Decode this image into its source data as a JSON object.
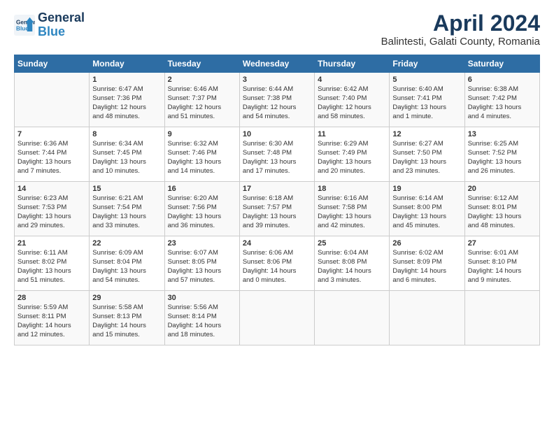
{
  "header": {
    "logo_line1": "General",
    "logo_line2": "Blue",
    "title": "April 2024",
    "subtitle": "Balintesti, Galati County, Romania"
  },
  "weekdays": [
    "Sunday",
    "Monday",
    "Tuesday",
    "Wednesday",
    "Thursday",
    "Friday",
    "Saturday"
  ],
  "weeks": [
    [
      {
        "day": "",
        "content": ""
      },
      {
        "day": "1",
        "content": "Sunrise: 6:47 AM\nSunset: 7:36 PM\nDaylight: 12 hours\nand 48 minutes."
      },
      {
        "day": "2",
        "content": "Sunrise: 6:46 AM\nSunset: 7:37 PM\nDaylight: 12 hours\nand 51 minutes."
      },
      {
        "day": "3",
        "content": "Sunrise: 6:44 AM\nSunset: 7:38 PM\nDaylight: 12 hours\nand 54 minutes."
      },
      {
        "day": "4",
        "content": "Sunrise: 6:42 AM\nSunset: 7:40 PM\nDaylight: 12 hours\nand 58 minutes."
      },
      {
        "day": "5",
        "content": "Sunrise: 6:40 AM\nSunset: 7:41 PM\nDaylight: 13 hours\nand 1 minute."
      },
      {
        "day": "6",
        "content": "Sunrise: 6:38 AM\nSunset: 7:42 PM\nDaylight: 13 hours\nand 4 minutes."
      }
    ],
    [
      {
        "day": "7",
        "content": "Sunrise: 6:36 AM\nSunset: 7:44 PM\nDaylight: 13 hours\nand 7 minutes."
      },
      {
        "day": "8",
        "content": "Sunrise: 6:34 AM\nSunset: 7:45 PM\nDaylight: 13 hours\nand 10 minutes."
      },
      {
        "day": "9",
        "content": "Sunrise: 6:32 AM\nSunset: 7:46 PM\nDaylight: 13 hours\nand 14 minutes."
      },
      {
        "day": "10",
        "content": "Sunrise: 6:30 AM\nSunset: 7:48 PM\nDaylight: 13 hours\nand 17 minutes."
      },
      {
        "day": "11",
        "content": "Sunrise: 6:29 AM\nSunset: 7:49 PM\nDaylight: 13 hours\nand 20 minutes."
      },
      {
        "day": "12",
        "content": "Sunrise: 6:27 AM\nSunset: 7:50 PM\nDaylight: 13 hours\nand 23 minutes."
      },
      {
        "day": "13",
        "content": "Sunrise: 6:25 AM\nSunset: 7:52 PM\nDaylight: 13 hours\nand 26 minutes."
      }
    ],
    [
      {
        "day": "14",
        "content": "Sunrise: 6:23 AM\nSunset: 7:53 PM\nDaylight: 13 hours\nand 29 minutes."
      },
      {
        "day": "15",
        "content": "Sunrise: 6:21 AM\nSunset: 7:54 PM\nDaylight: 13 hours\nand 33 minutes."
      },
      {
        "day": "16",
        "content": "Sunrise: 6:20 AM\nSunset: 7:56 PM\nDaylight: 13 hours\nand 36 minutes."
      },
      {
        "day": "17",
        "content": "Sunrise: 6:18 AM\nSunset: 7:57 PM\nDaylight: 13 hours\nand 39 minutes."
      },
      {
        "day": "18",
        "content": "Sunrise: 6:16 AM\nSunset: 7:58 PM\nDaylight: 13 hours\nand 42 minutes."
      },
      {
        "day": "19",
        "content": "Sunrise: 6:14 AM\nSunset: 8:00 PM\nDaylight: 13 hours\nand 45 minutes."
      },
      {
        "day": "20",
        "content": "Sunrise: 6:12 AM\nSunset: 8:01 PM\nDaylight: 13 hours\nand 48 minutes."
      }
    ],
    [
      {
        "day": "21",
        "content": "Sunrise: 6:11 AM\nSunset: 8:02 PM\nDaylight: 13 hours\nand 51 minutes."
      },
      {
        "day": "22",
        "content": "Sunrise: 6:09 AM\nSunset: 8:04 PM\nDaylight: 13 hours\nand 54 minutes."
      },
      {
        "day": "23",
        "content": "Sunrise: 6:07 AM\nSunset: 8:05 PM\nDaylight: 13 hours\nand 57 minutes."
      },
      {
        "day": "24",
        "content": "Sunrise: 6:06 AM\nSunset: 8:06 PM\nDaylight: 14 hours\nand 0 minutes."
      },
      {
        "day": "25",
        "content": "Sunrise: 6:04 AM\nSunset: 8:08 PM\nDaylight: 14 hours\nand 3 minutes."
      },
      {
        "day": "26",
        "content": "Sunrise: 6:02 AM\nSunset: 8:09 PM\nDaylight: 14 hours\nand 6 minutes."
      },
      {
        "day": "27",
        "content": "Sunrise: 6:01 AM\nSunset: 8:10 PM\nDaylight: 14 hours\nand 9 minutes."
      }
    ],
    [
      {
        "day": "28",
        "content": "Sunrise: 5:59 AM\nSunset: 8:11 PM\nDaylight: 14 hours\nand 12 minutes."
      },
      {
        "day": "29",
        "content": "Sunrise: 5:58 AM\nSunset: 8:13 PM\nDaylight: 14 hours\nand 15 minutes."
      },
      {
        "day": "30",
        "content": "Sunrise: 5:56 AM\nSunset: 8:14 PM\nDaylight: 14 hours\nand 18 minutes."
      },
      {
        "day": "",
        "content": ""
      },
      {
        "day": "",
        "content": ""
      },
      {
        "day": "",
        "content": ""
      },
      {
        "day": "",
        "content": ""
      }
    ]
  ]
}
